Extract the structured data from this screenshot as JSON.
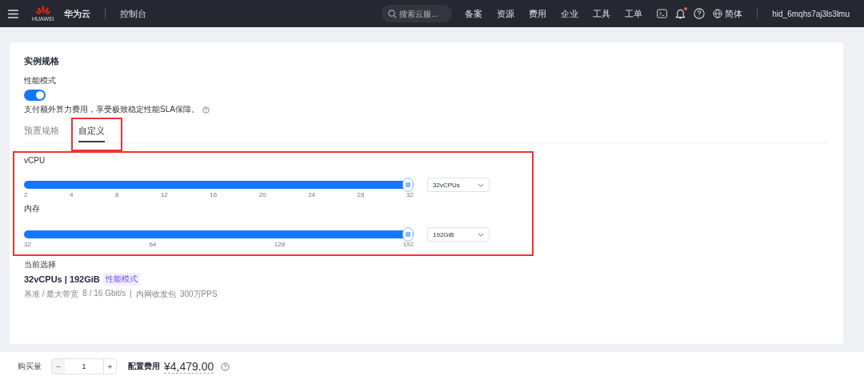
{
  "topbar": {
    "logo_text": "HUAWEI",
    "brand": "华为云",
    "console": "控制台",
    "search": {
      "placeholder": "搜索云服..."
    },
    "nav": [
      "备案",
      "资源",
      "费用",
      "企业",
      "工具",
      "工单"
    ],
    "notification_dot": true,
    "language": "简体",
    "user": "hid_6mqhs7aj3ls3lmu"
  },
  "spec": {
    "title": "实例规格",
    "mode_label": "性能模式",
    "mode_on": true,
    "mode_note": "支付额外算力费用，享受极致稳定性能SLA保障。",
    "tabs": [
      {
        "label": "预置规格",
        "selected": false,
        "highlighted": false
      },
      {
        "label": "自定义",
        "selected": true,
        "highlighted": true
      }
    ],
    "sliders_highlighted": true,
    "sliders": [
      {
        "label": "vCPU",
        "level": 1,
        "ticks": [
          "2",
          "4",
          "8",
          "12",
          "16",
          "20",
          "24",
          "28",
          "32"
        ],
        "value": "32vCPUs"
      },
      {
        "label": "内存",
        "level": 1,
        "ticks": [
          "32",
          "64",
          "128",
          "192"
        ],
        "value": "192GiB"
      }
    ],
    "current": {
      "label": "当前选择",
      "value": "32vCPUs | 192GiB",
      "tag": "性能模式",
      "details": [
        "基准 / 最大带宽",
        "8 / 16 Gbit/s",
        "|",
        "内网收发包",
        "300万PPS"
      ]
    }
  },
  "footer": {
    "quantity_label": "购买量",
    "minus": "−",
    "quantity": "1",
    "plus": "+",
    "price_label": "配置费用",
    "price": "¥4,479.00"
  }
}
